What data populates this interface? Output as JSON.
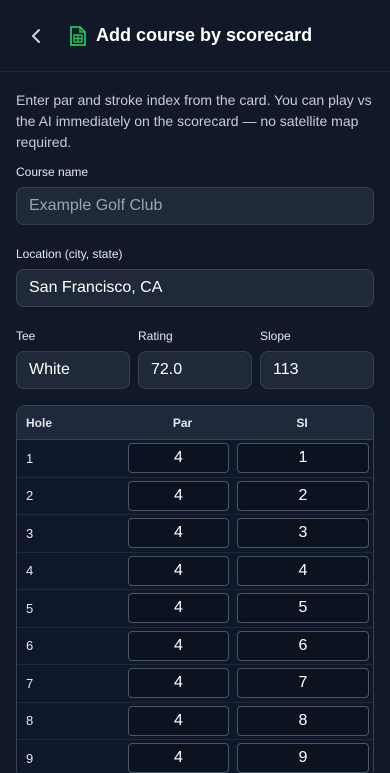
{
  "header": {
    "title": "Add course by scorecard",
    "back_icon": "chevron-left-icon",
    "doc_icon": "spreadsheet-icon",
    "accent": "#22c55e"
  },
  "intro": "Enter par and stroke index from the card. You can play vs the AI immediately on the scorecard — no satellite map required.",
  "course_name": {
    "label": "Course name",
    "placeholder": "Example Golf Club"
  },
  "location": {
    "label": "Location (city, state)",
    "value": "San Francisco, CA"
  },
  "tee": {
    "label": "Tee",
    "value": "White"
  },
  "rating": {
    "label": "Rating",
    "value": "72.0"
  },
  "slope": {
    "label": "Slope",
    "value": "113"
  },
  "table": {
    "headers": {
      "hole": "Hole",
      "par": "Par",
      "si": "SI"
    },
    "rows": [
      {
        "hole": "1",
        "par": "4",
        "si": "1"
      },
      {
        "hole": "2",
        "par": "4",
        "si": "2"
      },
      {
        "hole": "3",
        "par": "4",
        "si": "3"
      },
      {
        "hole": "4",
        "par": "4",
        "si": "4"
      },
      {
        "hole": "5",
        "par": "4",
        "si": "5"
      },
      {
        "hole": "6",
        "par": "4",
        "si": "6"
      },
      {
        "hole": "7",
        "par": "4",
        "si": "7"
      },
      {
        "hole": "8",
        "par": "4",
        "si": "8"
      },
      {
        "hole": "9",
        "par": "4",
        "si": "9"
      }
    ]
  }
}
